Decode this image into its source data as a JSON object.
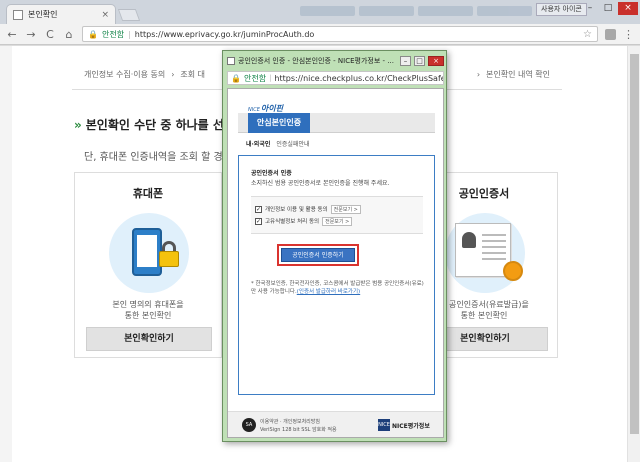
{
  "browser": {
    "tab_title": "본인확인",
    "tab_close": "×",
    "user_label": "사용자 아이콘",
    "url_secure": "안전함",
    "url": "https://www.eprivacy.go.kr/juminProcAuth.do",
    "nav": {
      "back": "←",
      "forward": "→",
      "reload": "C",
      "home": "⌂"
    },
    "menu": "⋮",
    "star": "☆",
    "win": {
      "min": "–",
      "max": "□",
      "close": "×"
    }
  },
  "page": {
    "steps": [
      "개인정보 수집·이용 동의",
      "조회 대",
      "본인확인 내역 확인"
    ],
    "step_arrow": "›",
    "section_arrows": "»",
    "section_title": "본인확인 수단 중 하나를 선택",
    "section_desc": "단, 휴대폰 인증내역을 조회 할 경",
    "cards": [
      {
        "name": "휴대폰",
        "desc1": "본인 명의의 휴대폰을",
        "desc2": "통한 본인확인",
        "button": "본인확인하기"
      },
      {
        "name": "공인인증서",
        "desc1": "본 공인인증서(유료발급)을",
        "desc2": "통한 본인확인",
        "button": "본인확인하기"
      }
    ]
  },
  "popup": {
    "title": "공인인증서 인증 - 안심본인인증 - NICE평가정보 - ...",
    "secure": "안전함",
    "url": "https://nice.checkplus.co.kr/CheckPlusSafeModel...",
    "win": {
      "min": "–",
      "max": "□",
      "close": "×"
    },
    "logo_small": "NICE",
    "logo": "아이핀",
    "tab_active": "안심본인인증",
    "subtabs": [
      "내·외국인",
      "인증실패안내"
    ],
    "box_heading": "공인인증서 인증",
    "box_desc": "소지하신 범용 공인인증서로 본인인증을 진행해 주세요.",
    "agreements": [
      {
        "label": "개인정보 이용 및 활용 동의",
        "view": "전문보기 >",
        "checked": "✓"
      },
      {
        "label": "고유식별정보 처리 동의",
        "view": "전문보기 >",
        "checked": "✓"
      }
    ],
    "action_button": "공인인증서 인증하기",
    "note": "* 한국정보인증, 한국전자인증, 코스콤에서 발급받은 범용 공인인증서(유료)만 사용 가능합니다.",
    "note_link": "(인증서 발급하러 바로가기)",
    "footer_sa": "SA",
    "footer_line1": "이용약관 · 개인정보처리방침",
    "footer_line2": "VeriSign 128 bit SSL 암호화 적용",
    "footer_brand_mark": "NICE",
    "footer_brand": "NICE평가정보"
  }
}
